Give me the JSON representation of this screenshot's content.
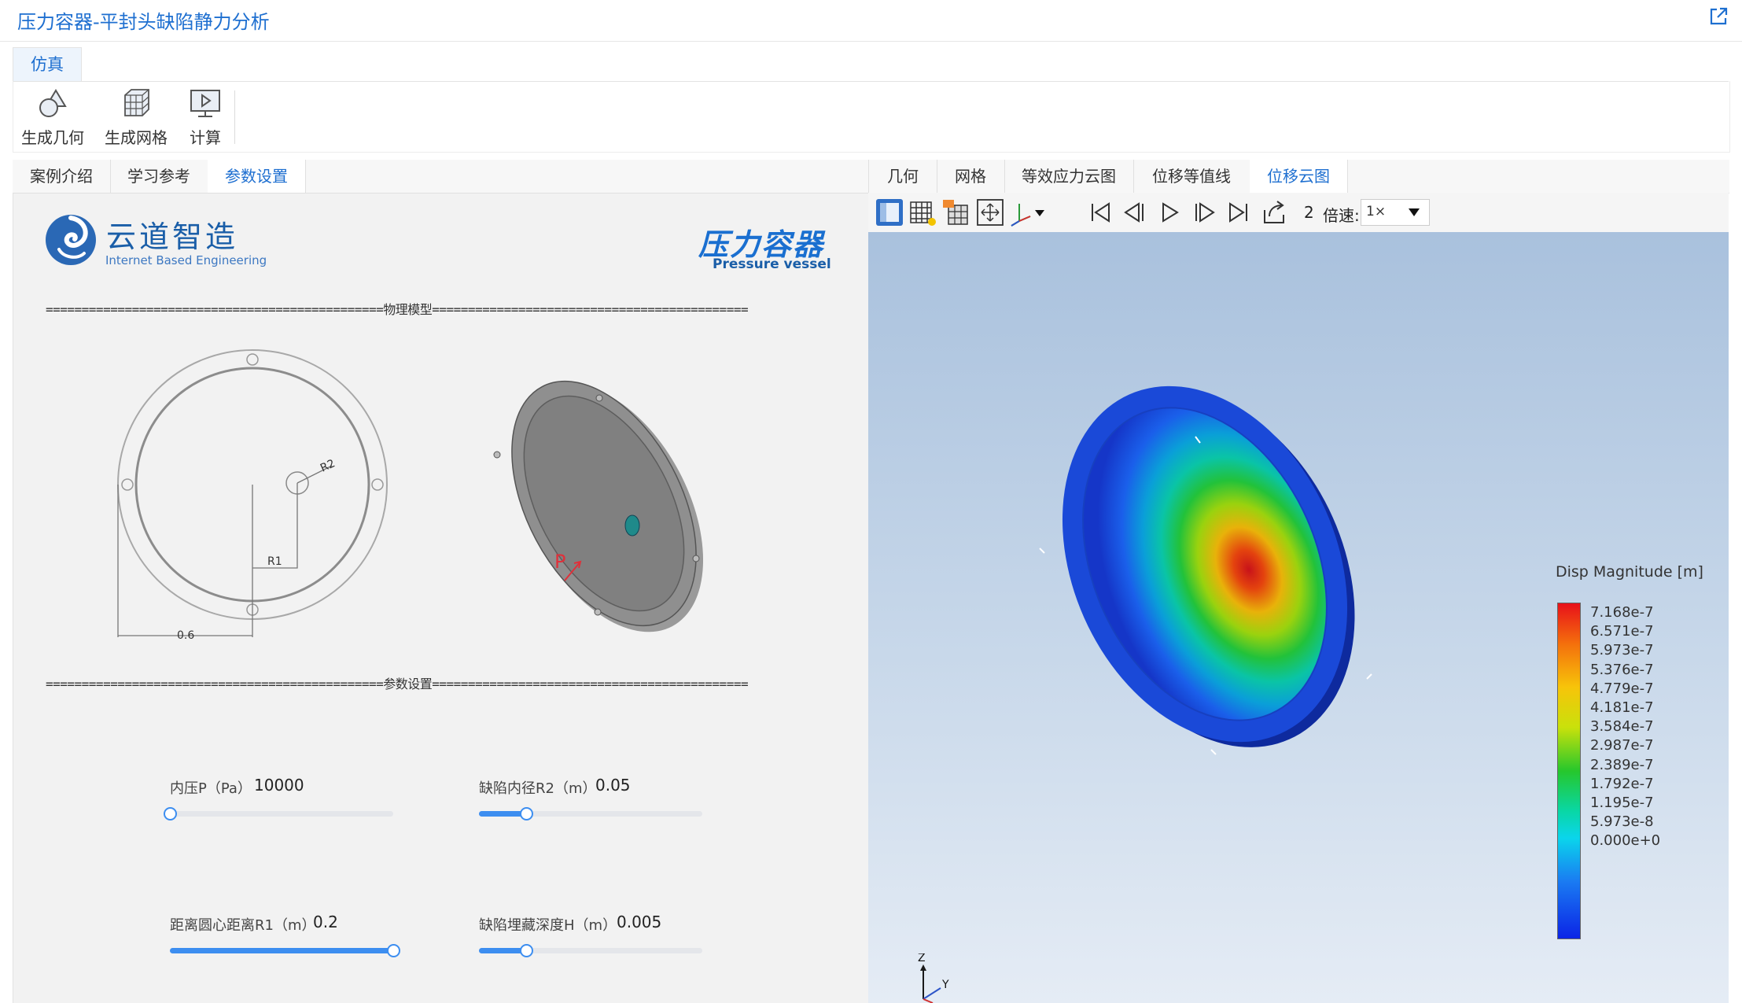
{
  "window": {
    "title": "压力容器-平封头缺陷静力分析"
  },
  "ribbon": {
    "tab": "仿真",
    "buttons": [
      {
        "label": "生成几何",
        "icon": "geometry-icon"
      },
      {
        "label": "生成网格",
        "icon": "mesh-icon"
      },
      {
        "label": "计算",
        "icon": "compute-icon"
      }
    ]
  },
  "left": {
    "tabs": [
      "案例介绍",
      "学习参考",
      "参数设置"
    ],
    "active_tab": "参数设置",
    "brand": {
      "name": "云道智造",
      "sub": "Internet Based Engineering"
    },
    "badge": {
      "title": "压力容器",
      "sub": "Pressure vessel"
    },
    "divider_model": "===============================================物理模型============================================",
    "divider_params": "===============================================参数设置============================================",
    "diagram_labels": {
      "r1": "R1",
      "r2": "R2",
      "dist": "0.6",
      "pressure": "P"
    },
    "params": [
      {
        "label": "内压P（Pa）",
        "value": "10000",
        "fraction": 0.0
      },
      {
        "label": "缺陷内径R2（m）",
        "value": "0.05",
        "fraction": 0.21
      },
      {
        "label": "距离圆心距离R1（m）",
        "value": "0.2",
        "fraction": 1.0
      },
      {
        "label": "缺陷埋藏深度H（m）",
        "value": "0.005",
        "fraction": 0.21
      }
    ]
  },
  "right": {
    "tabs": [
      "几何",
      "网格",
      "等效应力云图",
      "位移等值线",
      "位移云图"
    ],
    "active_tab": "位移云图",
    "toolbar": {
      "frame": "2",
      "speed_label": "倍速:",
      "speed_value": "1×"
    },
    "colorbar": {
      "title": "Disp Magnitude [m]",
      "labels": [
        "7.168e-7",
        "6.571e-7",
        "5.973e-7",
        "5.376e-7",
        "4.779e-7",
        "4.181e-7",
        "3.584e-7",
        "2.987e-7",
        "2.389e-7",
        "1.792e-7",
        "1.195e-7",
        "5.973e-8",
        "0.000e+0"
      ]
    },
    "axes": {
      "z": "Z",
      "y": "Y"
    }
  }
}
